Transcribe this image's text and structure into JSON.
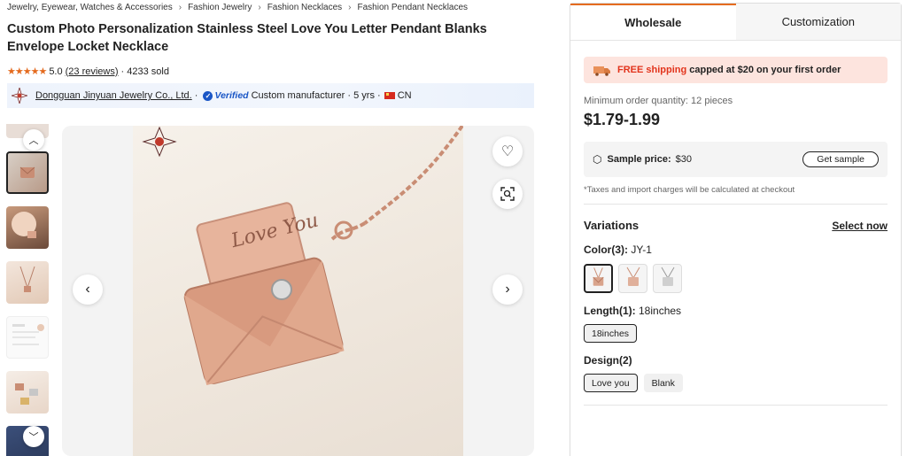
{
  "breadcrumb": [
    "Jewelry, Eyewear, Watches & Accessories",
    "Fashion Jewelry",
    "Fashion Necklaces",
    "Fashion Pendant Necklaces"
  ],
  "product": {
    "title": "Custom Photo Personalization Stainless Steel Love You Letter Pendant Blanks Envelope Locket Necklace",
    "stars": "★★★★★",
    "rating": "5.0",
    "reviews": "(23 reviews)",
    "sold": "4233 sold"
  },
  "supplier": {
    "name": "Dongguan Jinyuan Jewelry Co., Ltd.",
    "verified": "Verified",
    "type": "Custom manufacturer",
    "years": "5 yrs",
    "country": "CN"
  },
  "gallery": {
    "engraving": "Love You"
  },
  "panel": {
    "tabs": [
      "Wholesale",
      "Customization"
    ],
    "promo_free": "FREE shipping",
    "promo_rest": "capped at $20 on your first order",
    "moq": "Minimum order quantity: 12 pieces",
    "price": "$1.79-1.99",
    "sample_label": "Sample price:",
    "sample_price": "$30",
    "get_sample": "Get sample",
    "tax_note": "*Taxes and import charges will be calculated at checkout",
    "variations_title": "Variations",
    "select_now": "Select now",
    "color_label": "Color(3):",
    "color_value": "JY-1",
    "length_label": "Length(1):",
    "length_value": "18inches",
    "length_options": [
      "18inches"
    ],
    "design_label": "Design(2)",
    "design_options": [
      "Love you",
      "Blank"
    ]
  },
  "colors": {
    "accent": "#e46b1f",
    "promo_bg": "#fde4de",
    "free_red": "#e2341c",
    "verified_blue": "#1a56c6",
    "rose_gold": "#d9a48c"
  }
}
